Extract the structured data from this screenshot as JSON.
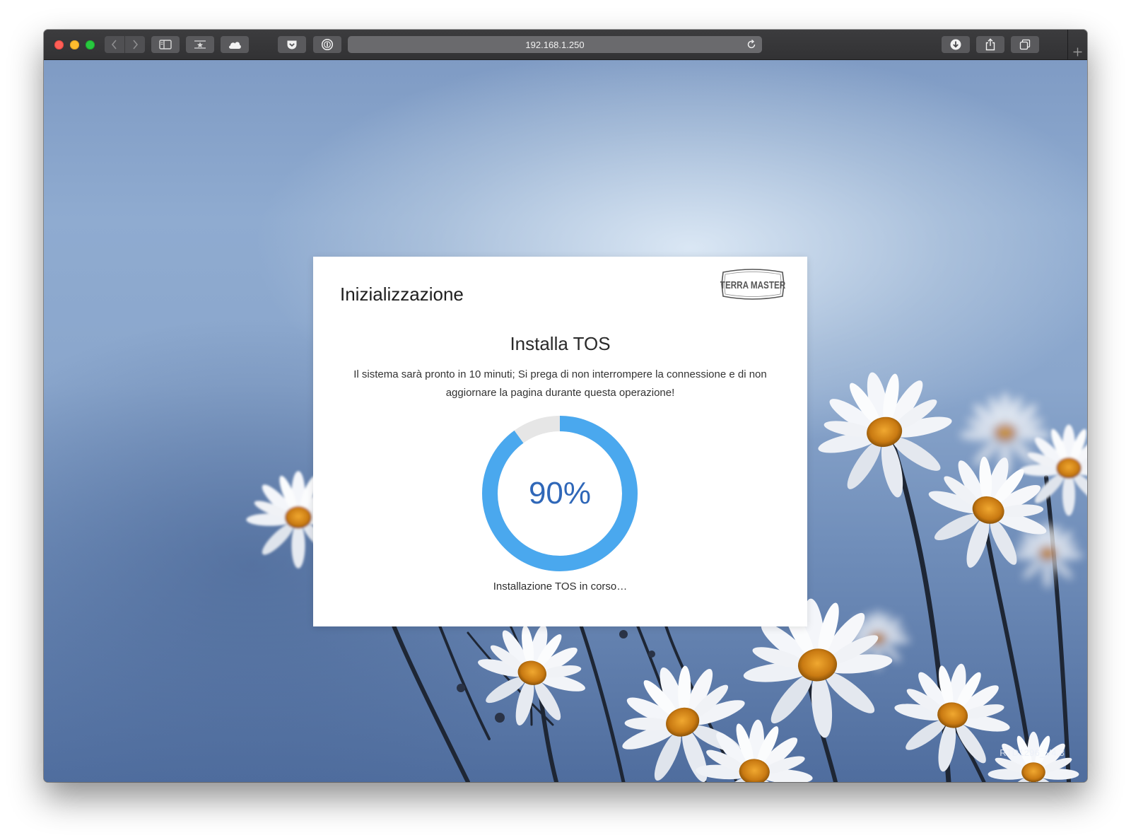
{
  "browser": {
    "address": "192.168.1.250",
    "icons": {
      "back": "chevron-left-icon",
      "forward": "chevron-right-icon",
      "sidebar": "sidebar-icon",
      "bookmarks": "bookmark-star-icon",
      "icloud": "cloud-icon",
      "pocket": "pocket-icon",
      "password": "password-manager-icon",
      "reload": "reload-icon",
      "downloads": "download-icon",
      "share": "share-icon",
      "tabs": "tab-overview-icon",
      "new_tab": "plus-icon"
    }
  },
  "dialog": {
    "title": "Inizializzazione",
    "logo_text": "TERRA MASTER",
    "heading": "Installa TOS",
    "description": "Il sistema sarà pronto in 10 minuti; Si prega di non interrompere la connessione e di non aggiornare la pagina durante questa operazione!",
    "progress_value": 0.9,
    "progress_label": "90%",
    "status": "Installazione TOS in corso…"
  },
  "footer": {
    "version": "RTD1296_V4.3"
  },
  "colors": {
    "progress_fill": "#4aa8ee",
    "progress_track": "#e6e6e6",
    "percent_text": "#2f67b8"
  }
}
